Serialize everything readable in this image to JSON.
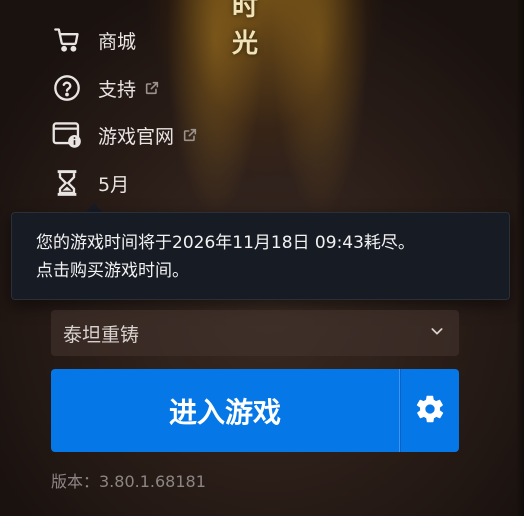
{
  "banner": {
    "title": "时 光"
  },
  "menu": {
    "items": [
      {
        "label": "商城",
        "icon": "cart-icon",
        "external": false
      },
      {
        "label": "支持",
        "icon": "help-circle-icon",
        "external": true
      },
      {
        "label": "游戏官网",
        "icon": "browser-info-icon",
        "external": true
      },
      {
        "label": "5月",
        "icon": "hourglass-icon",
        "external": false
      }
    ]
  },
  "tooltip": {
    "line1": "您的游戏时间将于2026年11月18日 09:43耗尽。",
    "line2": "点击购买游戏时间。"
  },
  "version_select": {
    "value": "泰坦重铸"
  },
  "play": {
    "label": "进入游戏"
  },
  "footer": {
    "version_text": "版本：3.80.1.68181"
  },
  "colors": {
    "accent": "#0677e6",
    "tooltip_bg": "#171b24",
    "text": "#e8e4e2"
  }
}
